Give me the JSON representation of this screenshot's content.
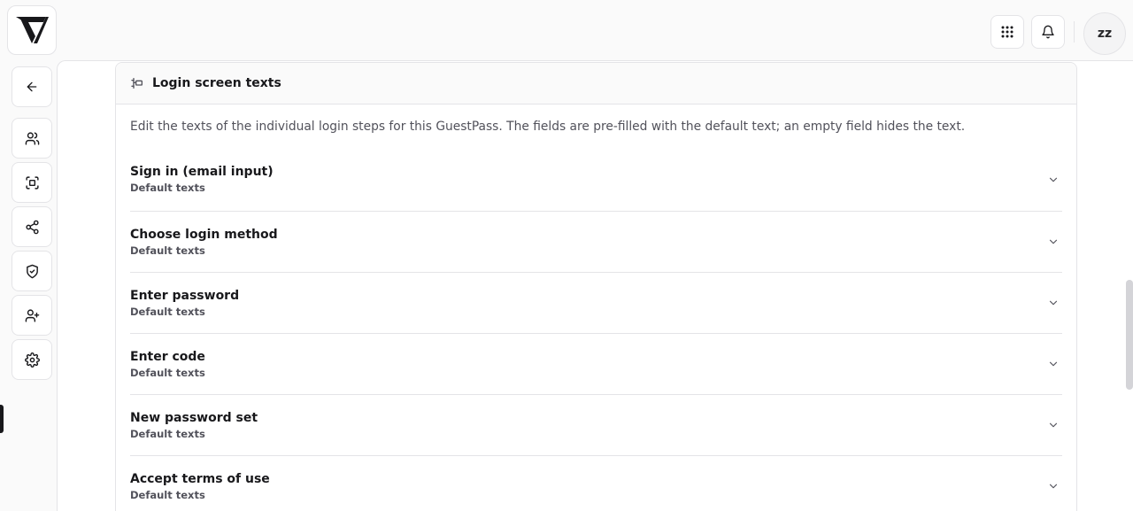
{
  "header": {
    "logo_icon": "brand-logo",
    "apps_icon": "grid-icon",
    "notifications_icon": "bell-icon",
    "user_initials": "zz"
  },
  "sidebar": {
    "items": [
      {
        "icon": "arrow-left-icon",
        "label": "back"
      },
      {
        "icon": "users-icon",
        "label": "users"
      },
      {
        "icon": "scan-face-icon",
        "label": "scan"
      },
      {
        "icon": "share-icon",
        "label": "share"
      },
      {
        "icon": "shield-check-icon",
        "label": "security"
      },
      {
        "icon": "user-plus-icon",
        "label": "invite"
      },
      {
        "icon": "gear-icon",
        "label": "settings",
        "active": true
      }
    ]
  },
  "card": {
    "title": "Login screen texts",
    "description": "Edit the texts of the individual login steps for this GuestPass. The fields are pre-filled with the default text; an empty field hides the text.",
    "sections": [
      {
        "title": "Sign in (email input)",
        "subtitle": "Default texts"
      },
      {
        "title": "Choose login method",
        "subtitle": "Default texts"
      },
      {
        "title": "Enter password",
        "subtitle": "Default texts"
      },
      {
        "title": "Enter code",
        "subtitle": "Default texts"
      },
      {
        "title": "New password set",
        "subtitle": "Default texts"
      },
      {
        "title": "Accept terms of use",
        "subtitle": "Default texts"
      }
    ]
  },
  "colors": {
    "background": "#fafafa",
    "surface": "#ffffff",
    "border": "#e4e4e7",
    "text": "#18181b",
    "muted": "#52525b"
  }
}
